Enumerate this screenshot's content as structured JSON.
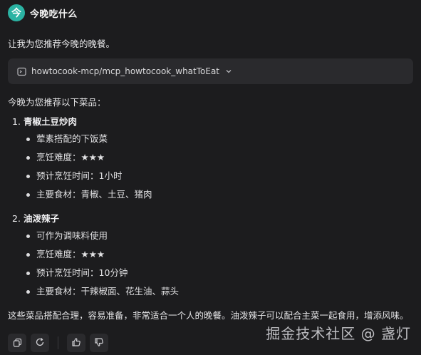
{
  "app": {
    "title": "今晚吃什么",
    "logo_char": "今"
  },
  "intro_text": "让我为您推荐今晚的晚餐。",
  "tool_call": {
    "label": "howtocook-mcp/mcp_howtocook_whatToEat"
  },
  "lead_text": "今晚为您推荐以下菜品：",
  "dishes": [
    {
      "number": "1.",
      "name": "青椒土豆炒肉",
      "bullets": [
        "荤素搭配的下饭菜",
        "烹饪难度：★★★",
        "预计烹饪时间：1小时",
        "主要食材：青椒、土豆、猪肉"
      ]
    },
    {
      "number": "2.",
      "name": "油泼辣子",
      "bullets": [
        "可作为调味料使用",
        "烹饪难度：★★★",
        "预计烹饪时间：10分钟",
        "主要食材：干辣椒面、花生油、蒜头"
      ]
    }
  ],
  "summary_text": "这些菜品搭配合理，容易准备，非常适合一个人的晚餐。油泼辣子可以配合主菜一起食用，增添风味。",
  "actions": {
    "icons": [
      "copy-icon",
      "regenerate-icon",
      "thumbs-up-icon",
      "thumbs-down-icon"
    ]
  },
  "watermark": "掘金技术社区 @ 盏灯",
  "colors": {
    "accent": "#2bb3a3",
    "background": "#1c1c1e",
    "card": "#2a2a2d"
  }
}
